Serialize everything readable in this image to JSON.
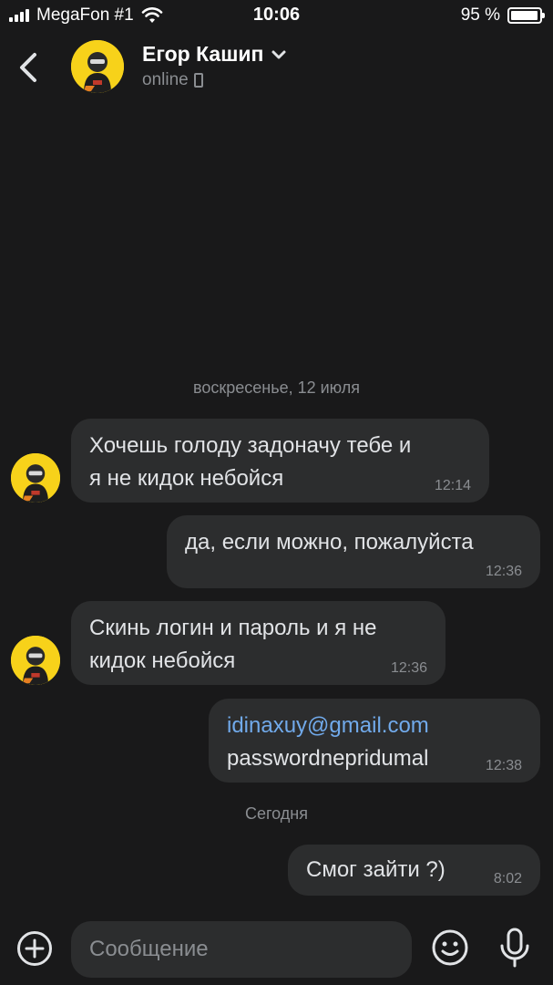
{
  "status_bar": {
    "carrier": "MegaFon #1",
    "time": "10:06",
    "battery": "95 %",
    "battery_level": 0.95
  },
  "header": {
    "contact_name": "Егор Кашип",
    "contact_status": "online"
  },
  "conversation": {
    "date_1": "воскресенье, 12 июля",
    "date_2": "Сегодня",
    "messages": [
      {
        "direction": "incoming",
        "lines": [
          "Хочешь голоду задоначу тебе и",
          "я не кидок небойся"
        ],
        "time": "12:14"
      },
      {
        "direction": "outgoing",
        "lines": [
          "да, если можно, пожалуйста"
        ],
        "time": "12:36"
      },
      {
        "direction": "incoming",
        "lines": [
          "Скинь логин и пароль и я не",
          "кидок небойся"
        ],
        "time": "12:36"
      },
      {
        "direction": "outgoing",
        "lines": [
          "idinaxuy@gmail.com",
          "passwordnepridumal"
        ],
        "time": "12:38"
      },
      {
        "direction": "outgoing",
        "lines": [
          "Смог зайти ?)"
        ],
        "time": "8:02"
      }
    ]
  },
  "composer": {
    "placeholder": "Сообщение"
  },
  "colors": {
    "background": "#19191a",
    "bubble": "#2c2d2e",
    "link": "#71aaeb",
    "avatar_bg": "#f7d21a"
  },
  "icons": [
    "back-icon",
    "chevron-down-icon",
    "phone-icon",
    "add-icon",
    "emoji-icon",
    "microphone-icon",
    "wifi-icon",
    "signal-icon",
    "battery-icon"
  ]
}
